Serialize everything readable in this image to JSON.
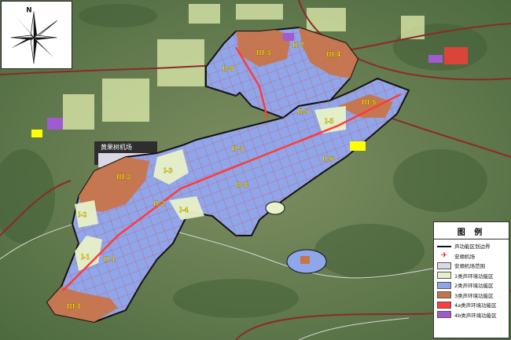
{
  "compass": {
    "north_label": "N"
  },
  "place_labels": {
    "airport": "黄果树机场"
  },
  "zone_labels": [
    "III-1",
    "III-2",
    "III-3",
    "III-4",
    "III-5",
    "II-1",
    "II-2",
    "II-3",
    "II-4",
    "II-5",
    "II-6",
    "II-7",
    "II-8",
    "I-1",
    "I-2",
    "I-3",
    "I-4",
    "I-5"
  ],
  "legend": {
    "title": "图 例",
    "items": [
      {
        "label": "声功能区划边界",
        "symbol": "line",
        "color": "#111111"
      },
      {
        "label": "安顺机场",
        "symbol": "airplane-icon",
        "color": "#dd2222"
      },
      {
        "label": "安顺机场范围",
        "symbol": "box",
        "color": "#d9d9e6"
      },
      {
        "label": "1类声环境功能区",
        "symbol": "box",
        "color": "#e8f1c8"
      },
      {
        "label": "2类声环境功能区",
        "symbol": "box",
        "color": "#8fa6ea"
      },
      {
        "label": "3类声环境功能区",
        "symbol": "box",
        "color": "#c8744a"
      },
      {
        "label": "4a类声环境功能区",
        "symbol": "box",
        "color": "#ff3b3b"
      },
      {
        "label": "4b类声环境功能区",
        "symbol": "box",
        "color": "#a05ad2"
      }
    ]
  },
  "colors": {
    "terrain": "#5f7a4f",
    "zone1": "#e8f1c8",
    "zone2": "#8fa6ea",
    "zone3": "#c8744a",
    "road": "#e23b3b",
    "boundary": "#111111",
    "label": "#fff200"
  }
}
